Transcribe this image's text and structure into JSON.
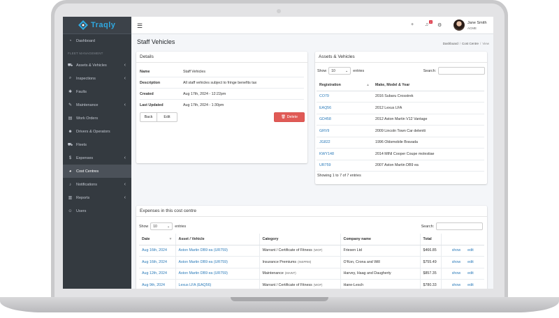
{
  "brand": {
    "name": "Traqly"
  },
  "sidebar": {
    "items": [
      {
        "label": "Dashboard",
        "icon": "speedometer-icon",
        "glyph": "◔",
        "chevron": false,
        "active": false
      },
      {
        "label": "FLEET MANAGEMENT",
        "header": true
      },
      {
        "label": "Assets & Vehicles",
        "icon": "car-icon",
        "glyph": "⛟",
        "chevron": true,
        "active": false
      },
      {
        "label": "Inspections",
        "icon": "search-icon",
        "glyph": "⌕",
        "chevron": true,
        "active": false
      },
      {
        "label": "Faults",
        "icon": "bug-icon",
        "glyph": "✱",
        "chevron": false,
        "active": false
      },
      {
        "label": "Maintenance",
        "icon": "wrench-icon",
        "glyph": "✎",
        "chevron": true,
        "active": false
      },
      {
        "label": "Work Orders",
        "icon": "clipboard-icon",
        "glyph": "▤",
        "chevron": false,
        "active": false
      },
      {
        "label": "Drivers & Operators",
        "icon": "users-icon",
        "glyph": "☻",
        "chevron": false,
        "active": false
      },
      {
        "label": "Fleets",
        "icon": "truck-icon",
        "glyph": "⛟",
        "chevron": false,
        "active": false
      },
      {
        "label": "Expenses",
        "icon": "dollar-icon",
        "glyph": "$",
        "chevron": true,
        "active": false
      },
      {
        "label": "Cost Centres",
        "icon": "pie-chart-icon",
        "glyph": "◕",
        "chevron": false,
        "active": true
      },
      {
        "label": "Notifications",
        "icon": "bell-icon",
        "glyph": "♪",
        "chevron": true,
        "active": false
      },
      {
        "label": "Reports",
        "icon": "chart-icon",
        "glyph": "▥",
        "chevron": true,
        "active": false
      },
      {
        "label": "Users",
        "icon": "user-icon",
        "glyph": "☺",
        "chevron": false,
        "active": false
      }
    ]
  },
  "topbar": {
    "menu_icon": "☰",
    "plus_icon": "+",
    "bell_icon": "♫",
    "bell_badge": "2",
    "gear_icon": "⚙",
    "user_name": "Jane Smith",
    "user_org": "ACME"
  },
  "page": {
    "title": "Staff Vehicles",
    "breadcrumb": [
      "Dashboard",
      "Cost Centre",
      "View"
    ]
  },
  "details": {
    "title": "Details",
    "rows": [
      {
        "k": "Name",
        "v": "Staff Vehicles"
      },
      {
        "k": "Description",
        "v": "All staff vehicles subject to fringe benefits tax"
      },
      {
        "k": "Created",
        "v": "Aug 17th, 2024 - 12:22pm"
      },
      {
        "k": "Last Updated",
        "v": "Aug 17th, 2024 - 1:30pm"
      }
    ],
    "back_label": "Back",
    "edit_label": "Edit",
    "delete_label": "Delete"
  },
  "assets": {
    "title": "Assets & Vehicles",
    "show_label": "Show",
    "entries_value": "10",
    "entries_label": "entries",
    "search_label": "Search:",
    "columns": [
      "Registration",
      "Make, Model & Year"
    ],
    "rows": [
      [
        "CO79",
        "2016 Subaru Crosstrek"
      ],
      [
        "EAQ56",
        "2012 Lexus LFA"
      ],
      [
        "GD458",
        "2012 Aston Martin V12 Vantage"
      ],
      [
        "GRV9",
        "2009 Lincoln Town Car deleniti"
      ],
      [
        "JG822",
        "1996 Oldsmobile Bravada"
      ],
      [
        "KWY148",
        "2014 MINI Cooper Coupe molestiae"
      ],
      [
        "UR759",
        "2007 Aston Martin DB9 ea"
      ]
    ],
    "info": "Showing 1 to 7 of 7 entries"
  },
  "expenses": {
    "title": "Expenses in this cost centre",
    "show_label": "Show",
    "entries_value": "10",
    "entries_label": "entries",
    "search_label": "Search:",
    "columns": [
      "Date",
      "Asset / Vehicle",
      "Category",
      "Company name",
      "Total",
      ""
    ],
    "rows": [
      {
        "date": "Aug 16th, 2024",
        "asset": "Aston Martin DB9 ea (UR759)",
        "category": "Warrant / Certificate of Fitness",
        "tag": "(WOF)",
        "company": "Friesen Ltd",
        "total": "$466.85",
        "show": "show",
        "edit": "edit"
      },
      {
        "date": "Aug 16th, 2024",
        "asset": "Aston Martin DB9 ea (UR759)",
        "category": "Insurance Premiums",
        "tag": "(INSPRM)",
        "company": "O'Kon, Crona and Will",
        "total": "$755.49",
        "show": "show",
        "edit": "edit"
      },
      {
        "date": "Aug 12th, 2024",
        "asset": "Aston Martin DB9 ea (UR759)",
        "category": "Maintenance",
        "tag": "(MAINT)",
        "company": "Harvey, Haag and Daugherty",
        "total": "$857.35",
        "show": "show",
        "edit": "edit"
      },
      {
        "date": "Aug 9th, 2024",
        "asset": "Lexus LFA (EAQ56)",
        "category": "Warrant / Certificate of Fitness",
        "tag": "(WOF)",
        "company": "Hane-Lesch",
        "total": "$780.33",
        "show": "show",
        "edit": "edit"
      }
    ]
  },
  "colors": {
    "sidebar": "#343a40",
    "brand": "#2fa8e0",
    "link": "#2a7ab9",
    "danger": "#e05a56"
  }
}
